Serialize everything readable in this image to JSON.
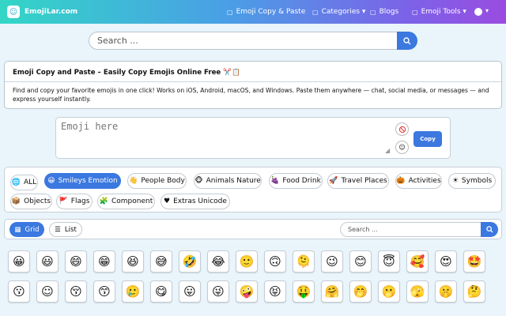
{
  "header": {
    "brand": "EmojiLar.com",
    "nav": [
      {
        "icon": "copy-icon",
        "label": "Emoji Copy & Paste"
      },
      {
        "icon": "folder-icon",
        "label": "Categories ▾"
      },
      {
        "icon": "book-icon",
        "label": "Blogs"
      },
      {
        "icon": "tools-icon",
        "label": "Emoji Tools ▾"
      }
    ]
  },
  "search": {
    "placeholder": "Search ..."
  },
  "intro": {
    "title": "Emoji Copy and Paste – Easily Copy Emojis Online Free ✂️📋",
    "text": "Find and copy your favorite emojis in one click! Works on iOS, Android, macOS, and Windows. Paste them anywhere — chat, social media, or messages — and express yourself instantly."
  },
  "emoji_box": {
    "placeholder": "Emoji here",
    "copy_label": "Copy"
  },
  "categories": [
    {
      "icon": "🌐",
      "label": "ALL",
      "active": false
    },
    {
      "icon": "😀",
      "label": "Smileys Emotion",
      "active": true
    },
    {
      "icon": "👋",
      "label": "People Body",
      "active": false
    },
    {
      "icon": "🐵",
      "label": "Animals Nature",
      "active": false
    },
    {
      "icon": "🍇",
      "label": "Food Drink",
      "active": false
    },
    {
      "icon": "🚀",
      "label": "Travel Places",
      "active": false
    },
    {
      "icon": "🎃",
      "label": "Activities",
      "active": false
    },
    {
      "icon": "☀",
      "label": "Symbols",
      "active": false
    },
    {
      "icon": "📦",
      "label": "Objects",
      "active": false
    },
    {
      "icon": "🚩",
      "label": "Flags",
      "active": false
    },
    {
      "icon": "🧩",
      "label": "Component",
      "active": false
    },
    {
      "icon": "♥",
      "label": "Extras Unicode",
      "active": false
    }
  ],
  "view": {
    "grid_label": "Grid",
    "list_label": "List",
    "search_placeholder": "Search ..."
  },
  "emojis": [
    [
      "😀",
      "😃",
      "😄",
      "😁",
      "😆",
      "😅",
      "🤣",
      "😂",
      "🙂",
      "🙃",
      "🫠",
      "😉",
      "😊",
      "😇",
      "🥰",
      "😍",
      "🤩"
    ],
    [
      "😗",
      "☺",
      "😚",
      "😙",
      "🥲",
      "😋",
      "😛",
      "😜",
      "🤪",
      "😝",
      "🤑",
      "🤗",
      "🤭",
      "🫢",
      "🫣",
      "🤫",
      "🤔"
    ]
  ],
  "colors": {
    "accent": "#3b78e0",
    "page_bg": "#e9f4fb"
  }
}
